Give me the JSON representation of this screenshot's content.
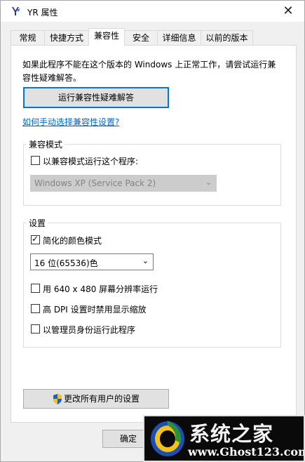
{
  "window": {
    "title": "YR 属性",
    "close_symbol": "✕"
  },
  "tabs": [
    {
      "label": "常规"
    },
    {
      "label": "快捷方式"
    },
    {
      "label": "兼容性"
    },
    {
      "label": "安全"
    },
    {
      "label": "详细信息"
    },
    {
      "label": "以前的版本"
    }
  ],
  "active_tab": "兼容性",
  "compat": {
    "intro_line1": "如果此程序不能在这个版本的 Windows 上正常工作，请尝试运行兼",
    "intro_line2": "容性疑难解答。",
    "troubleshoot_button": "运行兼容性疑难解答",
    "manual_link": "如何手动选择兼容性设置?"
  },
  "compat_mode": {
    "group_label": "兼容模式",
    "checkbox_label": "以兼容模式运行这个程序:",
    "checked": false,
    "os_selected": "Windows XP (Service Pack 2)"
  },
  "settings": {
    "group_label": "设置",
    "reduced_color": {
      "label": "简化的颜色模式",
      "checked": true
    },
    "color_depth_selected": "16 位(65536)色",
    "res_640": {
      "label": "用 640 x 480 屏幕分辨率运行",
      "checked": false
    },
    "high_dpi": {
      "label": "高 DPI 设置时禁用显示缩放",
      "checked": false
    },
    "run_as_admin": {
      "label": "以管理员身份运行此程序",
      "checked": false
    }
  },
  "all_users_button": "更改所有用户的设置",
  "footer": {
    "ok_button": "确定"
  },
  "watermark": {
    "title": "系统之家",
    "url": "www.Ghost123.com"
  },
  "colors": {
    "accent": "#0078d7",
    "link": "#0066cc"
  }
}
